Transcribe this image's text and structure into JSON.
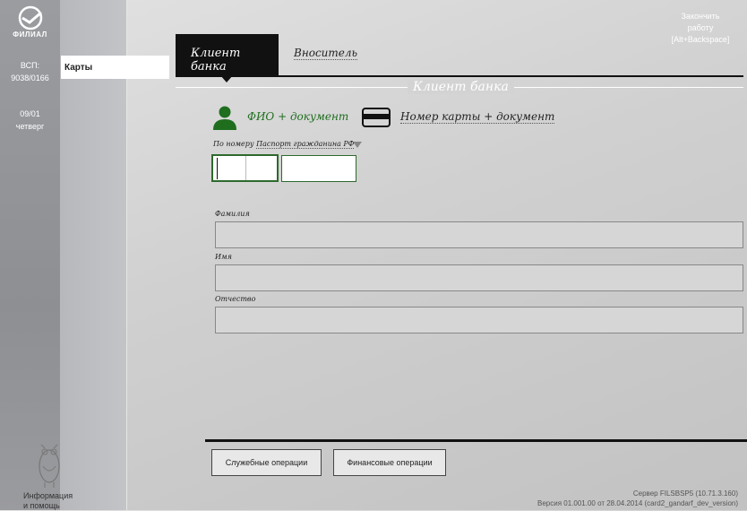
{
  "sidebar": {
    "logo_text": "ФИЛИАЛ",
    "vsp_label": "ВСП:",
    "vsp_value": "9038/0166",
    "date": "09/01",
    "weekday": "четверг",
    "help_line1": "Информация",
    "help_line2": "и помощь"
  },
  "menu": {
    "cards_label": "Карты"
  },
  "header": {
    "exit_line1": "Закончить",
    "exit_line2": "работу",
    "exit_line3": "[Alt+Backspace]"
  },
  "tabs": [
    {
      "label": "Клиент банка",
      "active": true
    },
    {
      "label": "Вноситель",
      "active": false
    }
  ],
  "section_title": "Клиент банка",
  "search_modes": {
    "fio": "ФИО + документ",
    "card": "Номер карты + документ",
    "fio_color": "#1e6e1e"
  },
  "document": {
    "prefix": "По номеру",
    "type": "Паспорт гражданина РФ",
    "series_value": "",
    "number_value": ""
  },
  "fields": {
    "surname_label": "Фамилия",
    "surname_value": "",
    "name_label": "Имя",
    "name_value": "",
    "patronymic_label": "Отчество",
    "patronymic_value": ""
  },
  "buttons": {
    "service": "Служебные операции",
    "finance": "Финансовые операции"
  },
  "footer": {
    "server": "Сервер FILSBSP5 (10.71.3.160)",
    "version": "Версия 01.001.00 от 28.04.2014 (card2_gandarf_dev_version)"
  }
}
